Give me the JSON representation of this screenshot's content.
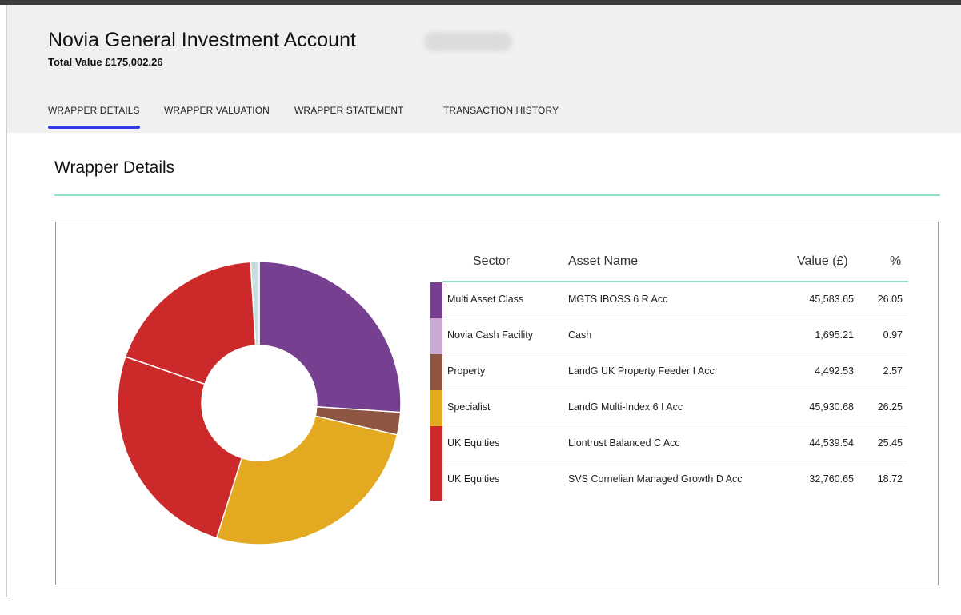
{
  "header": {
    "title": "Novia General Investment Account",
    "total_value": "Total Value £175,002.26"
  },
  "tabs": [
    {
      "label": "WRAPPER DETAILS",
      "active": true
    },
    {
      "label": "WRAPPER VALUATION",
      "active": false
    },
    {
      "label": "WRAPPER STATEMENT",
      "active": false
    },
    {
      "label": "TRANSACTION HISTORY",
      "active": false
    }
  ],
  "section": {
    "title": "Wrapper Details"
  },
  "table": {
    "headers": {
      "sector": "Sector",
      "asset": "Asset Name",
      "value": "Value (£)",
      "pct": "%"
    },
    "rows": [
      {
        "sector": "Multi Asset Class",
        "asset": "MGTS IBOSS 6 R Acc",
        "value": "45,583.65",
        "pct": "26.05",
        "color": "#773f8f"
      },
      {
        "sector": "Novia Cash Facility",
        "asset": "Cash",
        "value": "1,695.21",
        "pct": "0.97",
        "color": "#c9a9d2"
      },
      {
        "sector": "Property",
        "asset": "LandG UK Property Feeder I Acc",
        "value": "4,492.53",
        "pct": "2.57",
        "color": "#8e5642"
      },
      {
        "sector": "Specialist",
        "asset": "LandG Multi-Index 6 I Acc",
        "value": "45,930.68",
        "pct": "26.25",
        "color": "#e3a921"
      },
      {
        "sector": "UK Equities",
        "asset": "Liontrust Balanced C Acc",
        "value": "44,539.54",
        "pct": "25.45",
        "color": "#cc2a2a"
      },
      {
        "sector": "UK Equities",
        "asset": "SVS Cornelian Managed Growth D Acc",
        "value": "32,760.65",
        "pct": "18.72",
        "color": "#cc2a2a"
      }
    ]
  },
  "chart_data": {
    "type": "pie",
    "title": "",
    "slices": [
      {
        "label": "Multi Asset Class",
        "value": 26.05,
        "color": "#773f8f"
      },
      {
        "label": "Property",
        "value": 2.57,
        "color": "#8e5642"
      },
      {
        "label": "Specialist",
        "value": 26.25,
        "color": "#e3a921"
      },
      {
        "label": "UK Equities",
        "value": 25.45,
        "color": "#cc2a2a"
      },
      {
        "label": "UK Equities",
        "value": 18.72,
        "color": "#cc2a2a"
      },
      {
        "label": "Novia Cash Facility",
        "value": 0.97,
        "color": "#c6dede"
      }
    ]
  }
}
